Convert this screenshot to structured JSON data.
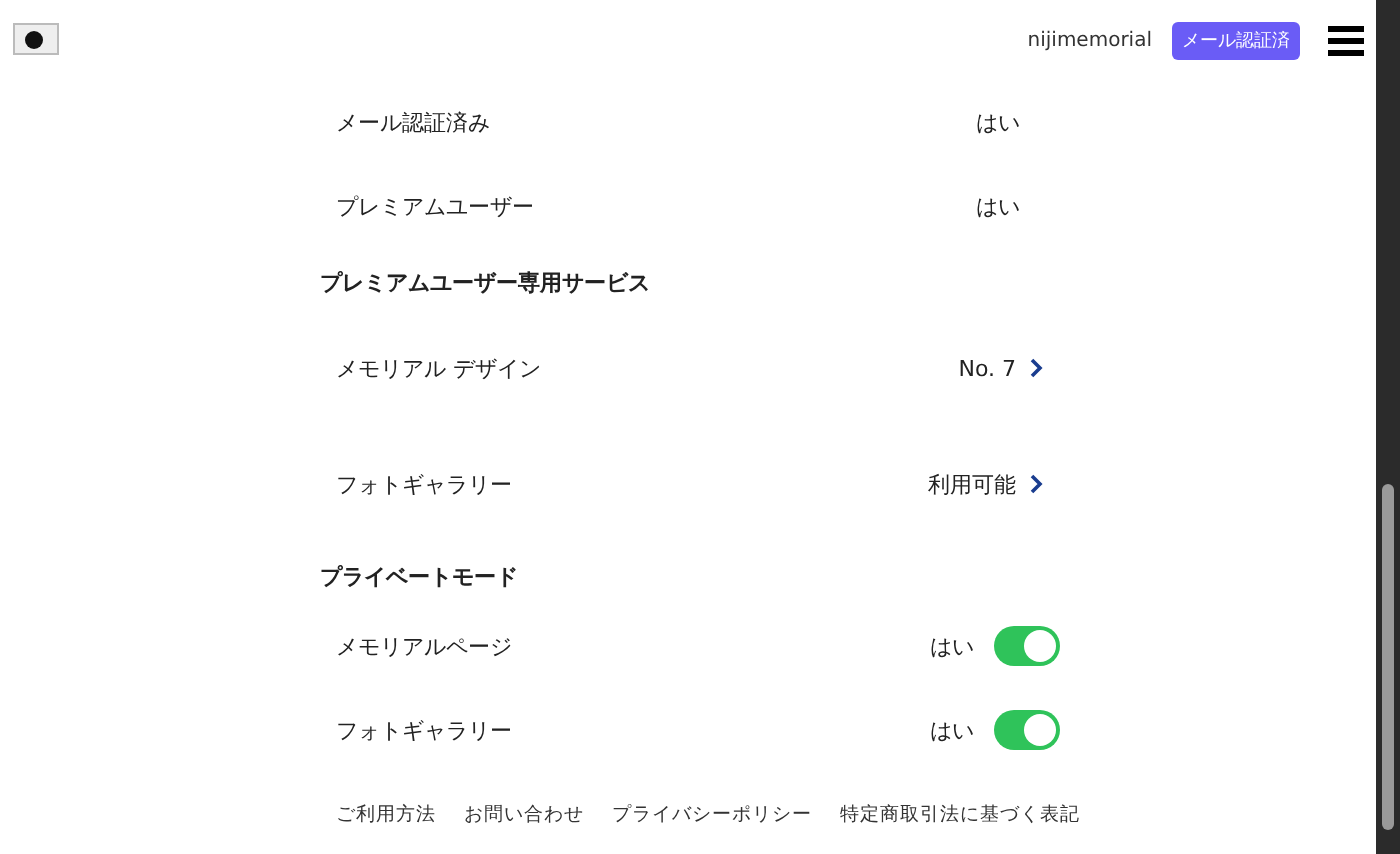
{
  "header": {
    "username": "nijimemorial",
    "badge": "メール認証済"
  },
  "sections": [
    {
      "rows": [
        {
          "kind": "info",
          "label": "メール認証済み",
          "value": "はい"
        },
        {
          "kind": "info",
          "label": "プレミアムユーザー",
          "value": "はい"
        }
      ]
    },
    {
      "heading": "プレミアムユーザー専用サービス",
      "rows": [
        {
          "kind": "link",
          "label": "メモリアル デザイン",
          "value": "No. 7"
        },
        {
          "kind": "link",
          "label": "フォトギャラリー",
          "value": "利用可能"
        }
      ]
    },
    {
      "heading": "プライベートモード",
      "rows": [
        {
          "kind": "toggle",
          "label": "メモリアルページ",
          "value": "はい",
          "on": true
        },
        {
          "kind": "toggle",
          "label": "フォトギャラリー",
          "value": "はい",
          "on": true
        }
      ]
    }
  ],
  "footer_links": [
    "ご利用方法",
    "お問い合わせ",
    "プライバシーポリシー",
    "特定商取引法に基づく表記"
  ]
}
